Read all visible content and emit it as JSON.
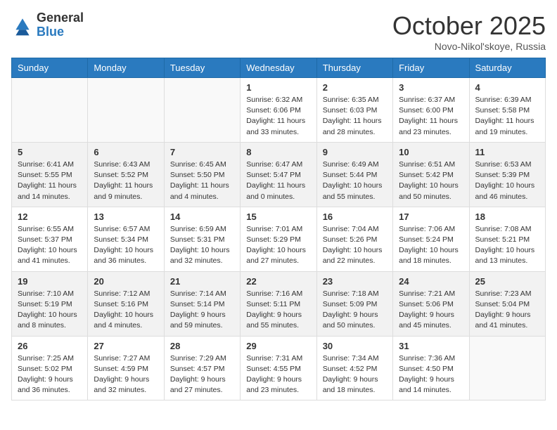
{
  "header": {
    "logo_line1": "General",
    "logo_line2": "Blue",
    "month": "October 2025",
    "location": "Novo-Nikol'skoye, Russia"
  },
  "days_of_week": [
    "Sunday",
    "Monday",
    "Tuesday",
    "Wednesday",
    "Thursday",
    "Friday",
    "Saturday"
  ],
  "weeks": [
    [
      {
        "num": "",
        "info": ""
      },
      {
        "num": "",
        "info": ""
      },
      {
        "num": "",
        "info": ""
      },
      {
        "num": "1",
        "info": "Sunrise: 6:32 AM\nSunset: 6:06 PM\nDaylight: 11 hours\nand 33 minutes."
      },
      {
        "num": "2",
        "info": "Sunrise: 6:35 AM\nSunset: 6:03 PM\nDaylight: 11 hours\nand 28 minutes."
      },
      {
        "num": "3",
        "info": "Sunrise: 6:37 AM\nSunset: 6:00 PM\nDaylight: 11 hours\nand 23 minutes."
      },
      {
        "num": "4",
        "info": "Sunrise: 6:39 AM\nSunset: 5:58 PM\nDaylight: 11 hours\nand 19 minutes."
      }
    ],
    [
      {
        "num": "5",
        "info": "Sunrise: 6:41 AM\nSunset: 5:55 PM\nDaylight: 11 hours\nand 14 minutes."
      },
      {
        "num": "6",
        "info": "Sunrise: 6:43 AM\nSunset: 5:52 PM\nDaylight: 11 hours\nand 9 minutes."
      },
      {
        "num": "7",
        "info": "Sunrise: 6:45 AM\nSunset: 5:50 PM\nDaylight: 11 hours\nand 4 minutes."
      },
      {
        "num": "8",
        "info": "Sunrise: 6:47 AM\nSunset: 5:47 PM\nDaylight: 11 hours\nand 0 minutes."
      },
      {
        "num": "9",
        "info": "Sunrise: 6:49 AM\nSunset: 5:44 PM\nDaylight: 10 hours\nand 55 minutes."
      },
      {
        "num": "10",
        "info": "Sunrise: 6:51 AM\nSunset: 5:42 PM\nDaylight: 10 hours\nand 50 minutes."
      },
      {
        "num": "11",
        "info": "Sunrise: 6:53 AM\nSunset: 5:39 PM\nDaylight: 10 hours\nand 46 minutes."
      }
    ],
    [
      {
        "num": "12",
        "info": "Sunrise: 6:55 AM\nSunset: 5:37 PM\nDaylight: 10 hours\nand 41 minutes."
      },
      {
        "num": "13",
        "info": "Sunrise: 6:57 AM\nSunset: 5:34 PM\nDaylight: 10 hours\nand 36 minutes."
      },
      {
        "num": "14",
        "info": "Sunrise: 6:59 AM\nSunset: 5:31 PM\nDaylight: 10 hours\nand 32 minutes."
      },
      {
        "num": "15",
        "info": "Sunrise: 7:01 AM\nSunset: 5:29 PM\nDaylight: 10 hours\nand 27 minutes."
      },
      {
        "num": "16",
        "info": "Sunrise: 7:04 AM\nSunset: 5:26 PM\nDaylight: 10 hours\nand 22 minutes."
      },
      {
        "num": "17",
        "info": "Sunrise: 7:06 AM\nSunset: 5:24 PM\nDaylight: 10 hours\nand 18 minutes."
      },
      {
        "num": "18",
        "info": "Sunrise: 7:08 AM\nSunset: 5:21 PM\nDaylight: 10 hours\nand 13 minutes."
      }
    ],
    [
      {
        "num": "19",
        "info": "Sunrise: 7:10 AM\nSunset: 5:19 PM\nDaylight: 10 hours\nand 8 minutes."
      },
      {
        "num": "20",
        "info": "Sunrise: 7:12 AM\nSunset: 5:16 PM\nDaylight: 10 hours\nand 4 minutes."
      },
      {
        "num": "21",
        "info": "Sunrise: 7:14 AM\nSunset: 5:14 PM\nDaylight: 9 hours\nand 59 minutes."
      },
      {
        "num": "22",
        "info": "Sunrise: 7:16 AM\nSunset: 5:11 PM\nDaylight: 9 hours\nand 55 minutes."
      },
      {
        "num": "23",
        "info": "Sunrise: 7:18 AM\nSunset: 5:09 PM\nDaylight: 9 hours\nand 50 minutes."
      },
      {
        "num": "24",
        "info": "Sunrise: 7:21 AM\nSunset: 5:06 PM\nDaylight: 9 hours\nand 45 minutes."
      },
      {
        "num": "25",
        "info": "Sunrise: 7:23 AM\nSunset: 5:04 PM\nDaylight: 9 hours\nand 41 minutes."
      }
    ],
    [
      {
        "num": "26",
        "info": "Sunrise: 7:25 AM\nSunset: 5:02 PM\nDaylight: 9 hours\nand 36 minutes."
      },
      {
        "num": "27",
        "info": "Sunrise: 7:27 AM\nSunset: 4:59 PM\nDaylight: 9 hours\nand 32 minutes."
      },
      {
        "num": "28",
        "info": "Sunrise: 7:29 AM\nSunset: 4:57 PM\nDaylight: 9 hours\nand 27 minutes."
      },
      {
        "num": "29",
        "info": "Sunrise: 7:31 AM\nSunset: 4:55 PM\nDaylight: 9 hours\nand 23 minutes."
      },
      {
        "num": "30",
        "info": "Sunrise: 7:34 AM\nSunset: 4:52 PM\nDaylight: 9 hours\nand 18 minutes."
      },
      {
        "num": "31",
        "info": "Sunrise: 7:36 AM\nSunset: 4:50 PM\nDaylight: 9 hours\nand 14 minutes."
      },
      {
        "num": "",
        "info": ""
      }
    ]
  ]
}
